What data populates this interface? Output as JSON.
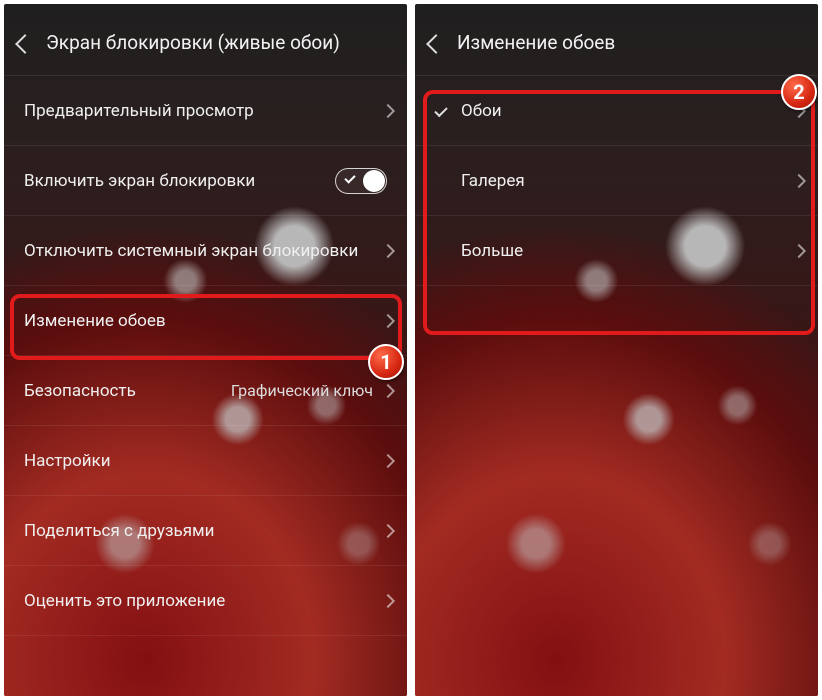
{
  "left": {
    "title": "Экран блокировки (живые обои)",
    "rows": {
      "preview": "Предварительный просмотр",
      "enable": "Включить экран блокировки",
      "disable_sys": "Отключить системный экран блокировки",
      "change_wp": "Изменение обоев",
      "security_label": "Безопасность",
      "security_value": "Графический ключ",
      "settings": "Настройки",
      "share": "Поделиться с друзьями",
      "rate": "Оценить это приложение"
    },
    "badge": "1"
  },
  "right": {
    "title": "Изменение обоев",
    "rows": {
      "wallpapers": "Обои",
      "gallery": "Галерея",
      "more": "Больше"
    },
    "badge": "2"
  },
  "colors": {
    "accent": "#e11b1b"
  }
}
